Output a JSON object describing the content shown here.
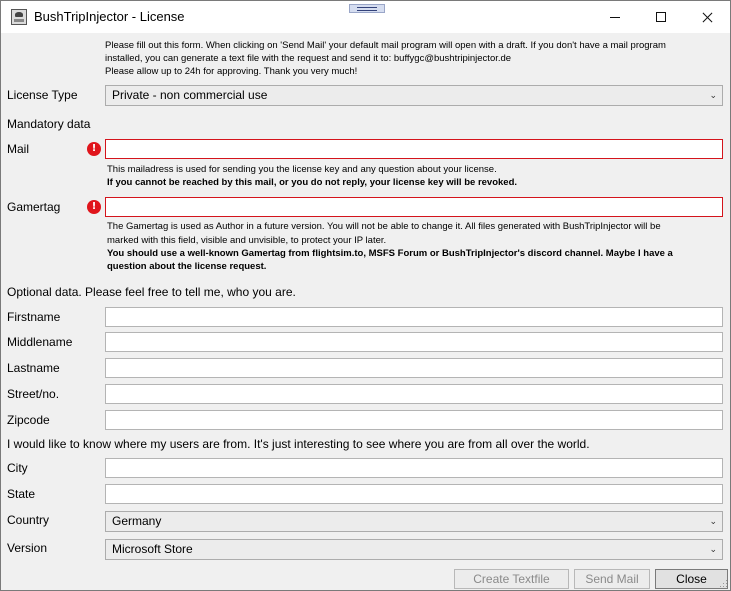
{
  "window": {
    "title": "BushTripInjector - License"
  },
  "intro": {
    "line1": "Please fill out this form. When clicking on 'Send Mail' your default mail program will open with a draft. If you don't have a mail program",
    "line2": "installed, you can generate a text file with the request and send it to: buffygc@bushtripinjector.de",
    "line3": "Please allow up to 24h for approving. Thank you very much!"
  },
  "license_type": {
    "label": "License Type",
    "value": "Private - non commercial use"
  },
  "mandatory": {
    "heading": "Mandatory data",
    "mail": {
      "label": "Mail",
      "value": "",
      "hint1": "This mailadress is used for sending you the license key and any question about your license.",
      "hint2": "If you cannot be reached by this mail, or you do not reply, your license key will be revoked."
    },
    "gamertag": {
      "label": "Gamertag",
      "value": "",
      "hint1": "The Gamertag is used as Author in a future version. You will not be able to change it. All files generated with BushTripInjector will be",
      "hint2": "marked with this field, visible and unvisible, to protect your IP later.",
      "hint3": "You should use a well-known Gamertag from flightsim.to, MSFS Forum or BushTripInjector's discord channel. Maybe I have a",
      "hint4": "question about the license request."
    },
    "error_glyph": "!"
  },
  "optional": {
    "heading": "Optional data. Please feel free to tell me, who you are.",
    "firstname": {
      "label": "Firstname",
      "value": ""
    },
    "middlename": {
      "label": "Middlename",
      "value": ""
    },
    "lastname": {
      "label": "Lastname",
      "value": ""
    },
    "street": {
      "label": "Street/no.",
      "value": ""
    },
    "zipcode": {
      "label": "Zipcode",
      "value": ""
    }
  },
  "location": {
    "heading": "I would like to know where my users are from. It's just interesting to see where you are from all over the world.",
    "city": {
      "label": "City",
      "value": ""
    },
    "state": {
      "label": "State",
      "value": ""
    },
    "country": {
      "label": "Country",
      "value": "Germany"
    },
    "version": {
      "label": "Version",
      "value": "Microsoft Store"
    }
  },
  "buttons": {
    "create_textfile": "Create Textfile",
    "send_mail": "Send Mail",
    "close": "Close"
  },
  "icons": {
    "chevron": "⌄",
    "error": "error-icon"
  },
  "colors": {
    "error": "#d4141c",
    "window_bg": "#f0f0f0"
  }
}
